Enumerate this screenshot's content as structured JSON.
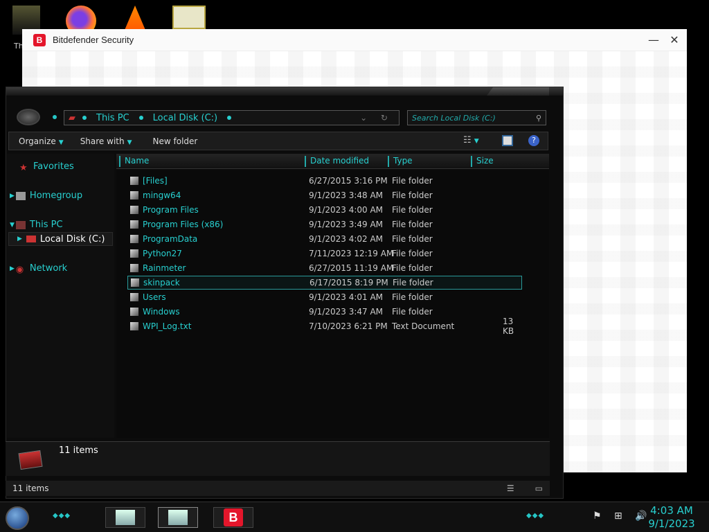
{
  "desktop": {
    "label_fragment": "Th"
  },
  "bitdefender": {
    "title": "Bitdefender Security",
    "logo": "B",
    "minimize": "—",
    "close": "✕"
  },
  "explorer": {
    "address": {
      "segments": [
        "This PC",
        "Local Disk (C:)"
      ],
      "icons": "⌄ ↻"
    },
    "search_placeholder": "Search Local Disk (C:)",
    "toolbar": {
      "organize": "Organize",
      "share_with": "Share with",
      "new_folder": "New folder"
    },
    "nav": {
      "favorites": "Favorites",
      "homegroup": "Homegroup",
      "this_pc": "This PC",
      "local_disk": "Local Disk (C:)",
      "network": "Network"
    },
    "columns": {
      "name": "Name",
      "date": "Date modified",
      "type": "Type",
      "size": "Size"
    },
    "rows": [
      {
        "name": "[Files]",
        "date": "6/27/2015 3:16 PM",
        "type": "File folder",
        "size": ""
      },
      {
        "name": "mingw64",
        "date": "9/1/2023 3:48 AM",
        "type": "File folder",
        "size": ""
      },
      {
        "name": "Program Files",
        "date": "9/1/2023 4:00 AM",
        "type": "File folder",
        "size": ""
      },
      {
        "name": "Program Files (x86)",
        "date": "9/1/2023 3:49 AM",
        "type": "File folder",
        "size": ""
      },
      {
        "name": "ProgramData",
        "date": "9/1/2023 4:02 AM",
        "type": "File folder",
        "size": ""
      },
      {
        "name": "Python27",
        "date": "7/11/2023 12:19 AM",
        "type": "File folder",
        "size": ""
      },
      {
        "name": "Rainmeter",
        "date": "6/27/2015 11:19 AM",
        "type": "File folder",
        "size": ""
      },
      {
        "name": "skinpack",
        "date": "6/17/2015 8:19 PM",
        "type": "File folder",
        "size": ""
      },
      {
        "name": "Users",
        "date": "9/1/2023 4:01 AM",
        "type": "File folder",
        "size": ""
      },
      {
        "name": "Windows",
        "date": "9/1/2023 3:47 AM",
        "type": "File folder",
        "size": ""
      },
      {
        "name": "WPI_Log.txt",
        "date": "7/10/2023 6:21 PM",
        "type": "Text Document",
        "size": "13 KB"
      }
    ],
    "details_count": "11 items",
    "status_count": "11 items"
  },
  "taskbar": {
    "bd_label": "B",
    "time": "4:03 AM",
    "date": "9/1/2023",
    "tray_icons": "⚑ ⊞ 🔊"
  },
  "colors": {
    "accent": "#28d0d0",
    "bitdefender_red": "#e4162b"
  }
}
